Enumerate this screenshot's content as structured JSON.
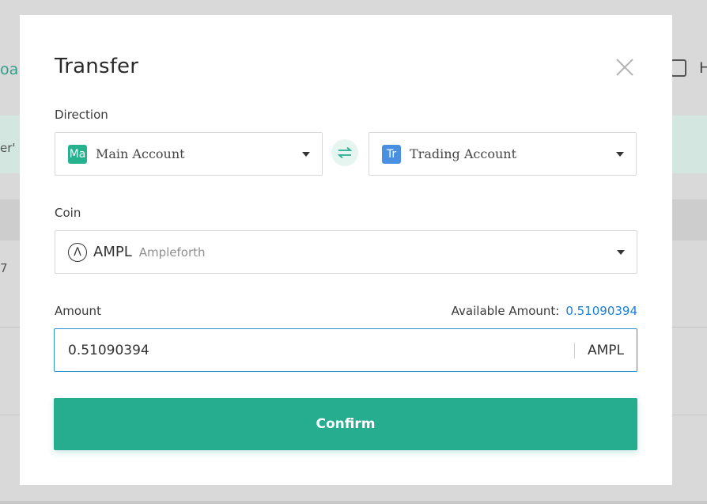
{
  "background": {
    "fragment_left_top": "oa",
    "fragment_left_mid": "er' a",
    "fragment_left_row": "7",
    "fragment_right": "H"
  },
  "modal": {
    "title": "Transfer",
    "direction_label": "Direction",
    "from_account": {
      "badge": "Ma",
      "name": "Main Account",
      "badge_color": "#26b28e"
    },
    "to_account": {
      "badge": "Tr",
      "name": "Trading Account",
      "badge_color": "#4a90e2"
    },
    "coin_label": "Coin",
    "coin": {
      "icon": "Λ",
      "symbol": "AMPL",
      "name": "Ampleforth"
    },
    "amount_label": "Amount",
    "available_label": "Available Amount:",
    "available_value": "0.51090394",
    "amount_value": "0.51090394",
    "amount_unit": "AMPL",
    "confirm_label": "Confirm"
  },
  "colors": {
    "accent": "#26ad8f",
    "link": "#1c7fd6",
    "input_focus": "#2b8ecf"
  }
}
